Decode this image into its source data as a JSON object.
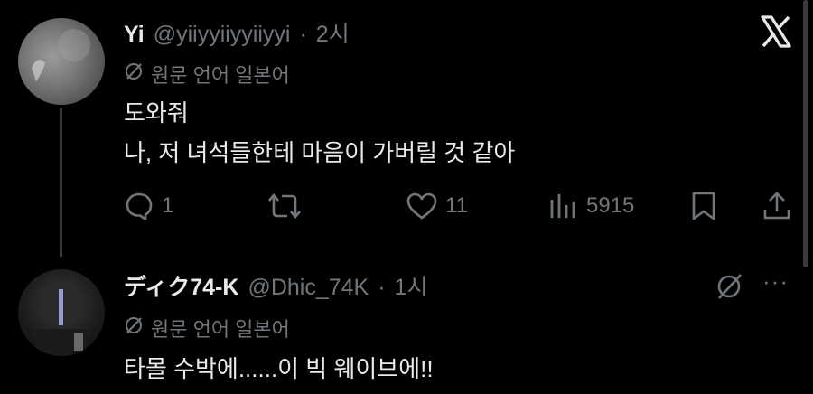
{
  "colors": {
    "background": "#000000",
    "primary_text": "#e7e9ea",
    "secondary_text": "#71767b",
    "thread_line": "#333639"
  },
  "post1": {
    "display_name": "Yi",
    "handle": "@yiiyyiiyyiiyyi",
    "separator": "·",
    "time": "2시",
    "translate_label": "원문 언어 일본어",
    "translate_icon": "no-translate-icon",
    "lines": [
      "도와줘",
      "나, 저 녀석들한테 마음이 가버릴 것 같아"
    ],
    "actions": {
      "reply_count": "1",
      "repost_count": "",
      "like_count": "11",
      "views_count": "5915"
    },
    "top_right_icon": "x-logo-icon"
  },
  "post2": {
    "display_name": "ディク74-K",
    "handle": "@Dhic_74K",
    "separator": "·",
    "time": "1시",
    "translate_label": "원문 언어 일본어",
    "text": "타몰 수박에......이 빅 웨이브에!!",
    "more_label": "···"
  }
}
